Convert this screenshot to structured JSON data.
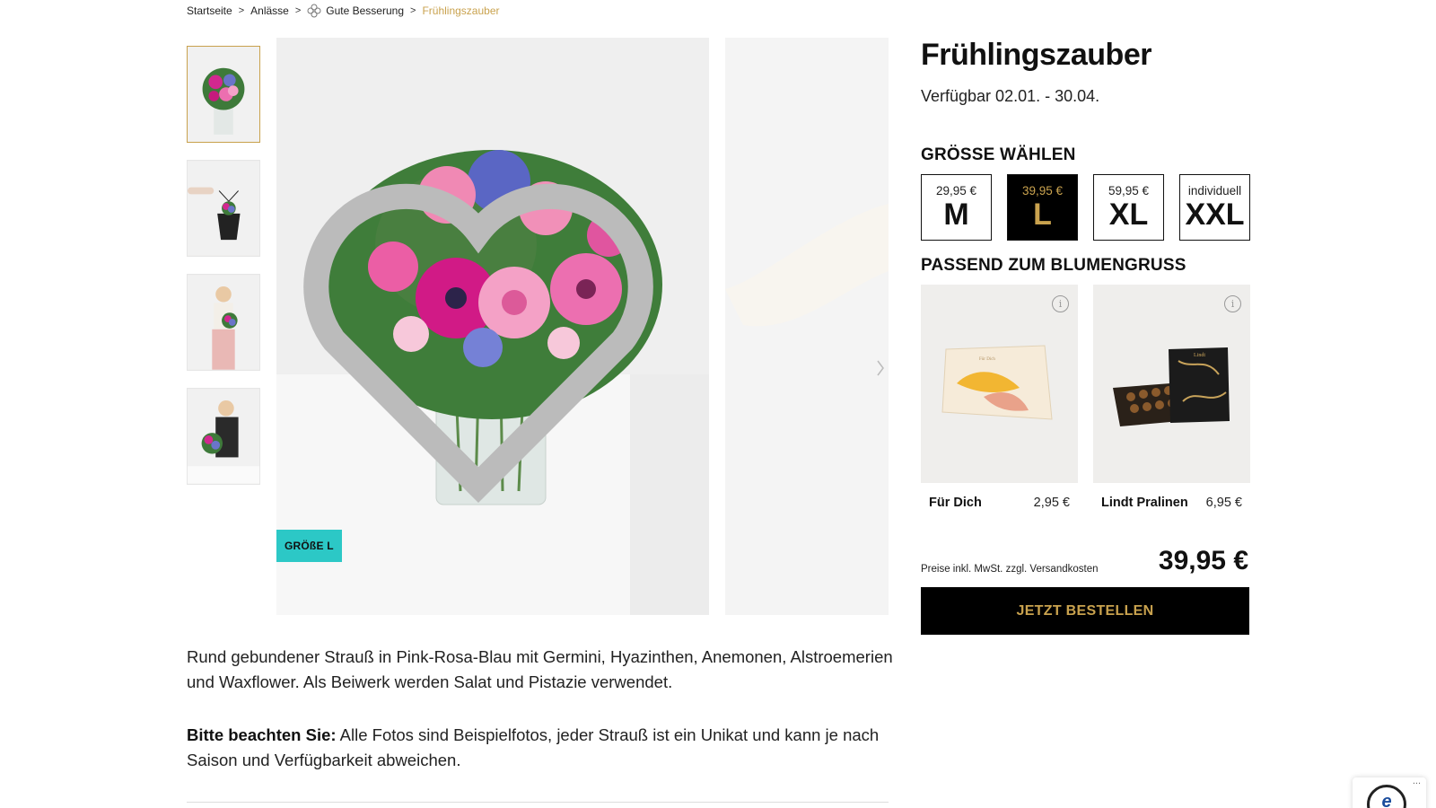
{
  "breadcrumb": {
    "items": [
      "Startseite",
      "Anlässe",
      "Gute Besserung"
    ],
    "current": "Frühlingszauber",
    "separator": ">"
  },
  "product": {
    "title": "Frühlingszauber",
    "availability": "Verfügbar 02.01. - 30.04.",
    "badge": "GRÖßE L",
    "description": "Rund gebundener Strauß in Pink-Rosa-Blau mit Germini, Hyazinthen, Anemonen, Alstroemerien und Waxflower. Als Beiwerk werden Salat und Pistazie verwendet.",
    "note_label": "Bitte beachten Sie:",
    "note_text": " Alle Fotos sind Beispielfotos, jeder Strauß ist ein Unikat und kann je nach Saison und Verfügbarkeit abweichen."
  },
  "sizes": {
    "heading": "Größe wählen",
    "options": [
      {
        "price": "29,95 €",
        "label": "M",
        "selected": false
      },
      {
        "price": "39,95 €",
        "label": "L",
        "selected": true
      },
      {
        "price": "59,95 €",
        "label": "XL",
        "selected": false
      },
      {
        "price": "individuell",
        "label": "XXL",
        "selected": false
      }
    ]
  },
  "addons": {
    "heading": "Passend zum Blumengruß",
    "items": [
      {
        "name": "Für Dich",
        "price": "2,95 €",
        "card_text": "Für Dich"
      },
      {
        "name": "Lindt Pralinen",
        "price": "6,95 €",
        "brand": "Lindt"
      }
    ]
  },
  "checkout": {
    "vat_note": "Preise inkl. MwSt. zzgl. Versandkosten",
    "total": "39,95 €",
    "order_button": "JETZT BESTELLEN"
  },
  "trusted": {
    "seal": "e",
    "menu": "..."
  },
  "colors": {
    "gold": "#c9a24e",
    "teal": "#2cc8c6",
    "black": "#000000"
  },
  "icons": [
    "flower-icon",
    "heart-icon",
    "info-icon",
    "chevron-right-icon"
  ]
}
